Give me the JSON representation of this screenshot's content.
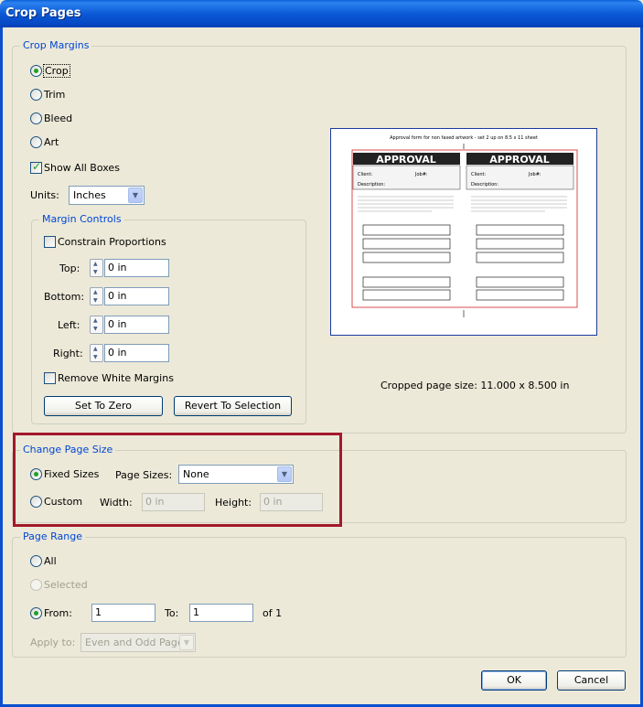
{
  "window": {
    "title": "Crop Pages"
  },
  "crop_margins": {
    "legend": "Crop Margins",
    "options": [
      "Crop",
      "Trim",
      "Bleed",
      "Art"
    ],
    "selected": "Crop",
    "show_all_boxes": "Show All Boxes",
    "units_label": "Units:",
    "units_value": "Inches"
  },
  "margin_controls": {
    "legend": "Margin Controls",
    "constrain": "Constrain Proportions",
    "top_label": "Top:",
    "top_value": "0 in",
    "bottom_label": "Bottom:",
    "bottom_value": "0 in",
    "left_label": "Left:",
    "left_value": "0 in",
    "right_label": "Right:",
    "right_value": "0 in",
    "remove_white": "Remove White Margins",
    "set_zero": "Set To Zero",
    "revert": "Revert To Selection"
  },
  "preview": {
    "heading": "Approval form for non faxed artwork - set 2 up on 8.5 x 11 sheet",
    "approval": "APPROVAL",
    "client": "Client:",
    "job": "Job#:",
    "description": "Description:",
    "cropped_size": "Cropped page size: 11.000 x 8.500 in"
  },
  "change_page_size": {
    "legend": "Change Page Size",
    "fixed": "Fixed Sizes",
    "page_sizes_label": "Page Sizes:",
    "page_sizes_value": "None",
    "custom": "Custom",
    "width_label": "Width:",
    "width_value": "0 in",
    "height_label": "Height:",
    "height_value": "0 in",
    "highlight_color": "#a3182b"
  },
  "page_range": {
    "legend": "Page Range",
    "all": "All",
    "selected": "Selected",
    "from_label": "From:",
    "from_value": "1",
    "to_label": "To:",
    "to_value": "1",
    "of": "of 1",
    "apply_to_label": "Apply to:",
    "apply_to_value": "Even and Odd Pages"
  },
  "buttons": {
    "ok": "OK",
    "cancel": "Cancel"
  }
}
